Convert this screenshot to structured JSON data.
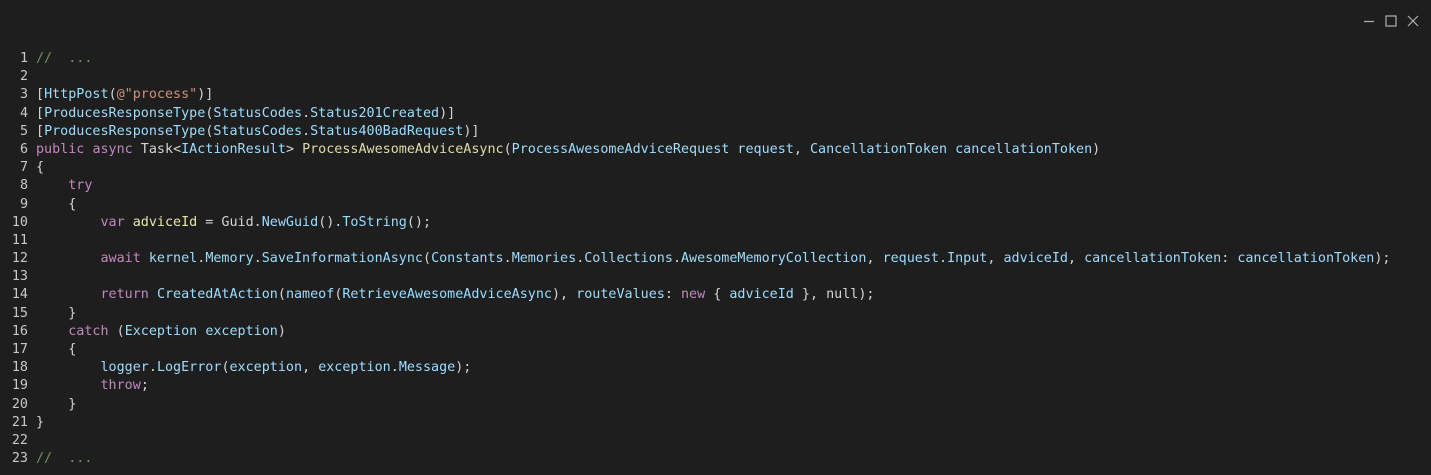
{
  "window": {
    "controls": {
      "minimize": "minimize-icon",
      "maximize": "maximize-icon",
      "close": "close-icon"
    }
  },
  "colors": {
    "background": "#1e1e1e",
    "comment": "#6a9955",
    "keyword": "#c586c0",
    "identifier": "#9cdcfe",
    "function": "#dcdcaa",
    "string": "#ce9178",
    "plain": "#d4d4d4"
  },
  "code": {
    "lines": [
      {
        "n": "1",
        "tokens": [
          {
            "c": "t-comment",
            "t": "//  ..."
          }
        ]
      },
      {
        "n": "2",
        "tokens": []
      },
      {
        "n": "3",
        "tokens": [
          {
            "c": "t-plain",
            "t": "["
          },
          {
            "c": "t-type",
            "t": "HttpPost"
          },
          {
            "c": "t-plain",
            "t": "("
          },
          {
            "c": "t-string",
            "t": "@\"process\""
          },
          {
            "c": "t-plain",
            "t": ")]"
          }
        ]
      },
      {
        "n": "4",
        "tokens": [
          {
            "c": "t-plain",
            "t": "["
          },
          {
            "c": "t-type",
            "t": "ProducesResponseType"
          },
          {
            "c": "t-plain",
            "t": "("
          },
          {
            "c": "t-type",
            "t": "StatusCodes"
          },
          {
            "c": "t-plain",
            "t": "."
          },
          {
            "c": "t-type",
            "t": "Status201Created"
          },
          {
            "c": "t-plain",
            "t": ")]"
          }
        ]
      },
      {
        "n": "5",
        "tokens": [
          {
            "c": "t-plain",
            "t": "["
          },
          {
            "c": "t-type",
            "t": "ProducesResponseType"
          },
          {
            "c": "t-plain",
            "t": "("
          },
          {
            "c": "t-type",
            "t": "StatusCodes"
          },
          {
            "c": "t-plain",
            "t": "."
          },
          {
            "c": "t-type",
            "t": "Status400BadRequest"
          },
          {
            "c": "t-plain",
            "t": ")]"
          }
        ]
      },
      {
        "n": "6",
        "tokens": [
          {
            "c": "t-keyword",
            "t": "public"
          },
          {
            "c": "t-plain",
            "t": " "
          },
          {
            "c": "t-keyword",
            "t": "async"
          },
          {
            "c": "t-plain",
            "t": " Task<"
          },
          {
            "c": "t-type",
            "t": "IActionResult"
          },
          {
            "c": "t-plain",
            "t": "> "
          },
          {
            "c": "t-func",
            "t": "ProcessAwesomeAdviceAsync"
          },
          {
            "c": "t-plain",
            "t": "("
          },
          {
            "c": "t-type",
            "t": "ProcessAwesomeAdviceRequest"
          },
          {
            "c": "t-plain",
            "t": " "
          },
          {
            "c": "t-var",
            "t": "request"
          },
          {
            "c": "t-plain",
            "t": ", "
          },
          {
            "c": "t-type",
            "t": "CancellationToken"
          },
          {
            "c": "t-plain",
            "t": " "
          },
          {
            "c": "t-var",
            "t": "cancellationToken"
          },
          {
            "c": "t-plain",
            "t": ")"
          }
        ]
      },
      {
        "n": "7",
        "tokens": [
          {
            "c": "t-plain",
            "t": "{"
          }
        ]
      },
      {
        "n": "8",
        "tokens": [
          {
            "c": "t-plain",
            "t": "    "
          },
          {
            "c": "t-keyword",
            "t": "try"
          }
        ]
      },
      {
        "n": "9",
        "tokens": [
          {
            "c": "t-plain",
            "t": "    {"
          }
        ]
      },
      {
        "n": "10",
        "tokens": [
          {
            "c": "t-plain",
            "t": "        "
          },
          {
            "c": "t-keyword",
            "t": "var"
          },
          {
            "c": "t-plain",
            "t": " "
          },
          {
            "c": "t-light",
            "t": "adviceId"
          },
          {
            "c": "t-plain",
            "t": " = Guid."
          },
          {
            "c": "t-type",
            "t": "NewGuid"
          },
          {
            "c": "t-plain",
            "t": "()."
          },
          {
            "c": "t-type",
            "t": "ToString"
          },
          {
            "c": "t-plain",
            "t": "();"
          }
        ]
      },
      {
        "n": "11",
        "tokens": []
      },
      {
        "n": "12",
        "tokens": [
          {
            "c": "t-plain",
            "t": "        "
          },
          {
            "c": "t-keyword",
            "t": "await"
          },
          {
            "c": "t-plain",
            "t": " "
          },
          {
            "c": "t-var",
            "t": "kernel"
          },
          {
            "c": "t-plain",
            "t": "."
          },
          {
            "c": "t-type",
            "t": "Memory"
          },
          {
            "c": "t-plain",
            "t": "."
          },
          {
            "c": "t-type",
            "t": "SaveInformationAsync"
          },
          {
            "c": "t-plain",
            "t": "("
          },
          {
            "c": "t-type",
            "t": "Constants"
          },
          {
            "c": "t-plain",
            "t": "."
          },
          {
            "c": "t-type",
            "t": "Memories"
          },
          {
            "c": "t-plain",
            "t": "."
          },
          {
            "c": "t-type",
            "t": "Collections"
          },
          {
            "c": "t-plain",
            "t": "."
          },
          {
            "c": "t-type",
            "t": "AwesomeMemoryCollection"
          },
          {
            "c": "t-plain",
            "t": ", "
          },
          {
            "c": "t-var",
            "t": "request"
          },
          {
            "c": "t-plain",
            "t": "."
          },
          {
            "c": "t-type",
            "t": "Input"
          },
          {
            "c": "t-plain",
            "t": ", "
          },
          {
            "c": "t-var",
            "t": "adviceId"
          },
          {
            "c": "t-plain",
            "t": ", "
          },
          {
            "c": "t-var",
            "t": "cancellationToken"
          },
          {
            "c": "t-plain",
            "t": ": "
          },
          {
            "c": "t-var",
            "t": "cancellationToken"
          },
          {
            "c": "t-plain",
            "t": ");"
          }
        ]
      },
      {
        "n": "13",
        "tokens": []
      },
      {
        "n": "14",
        "tokens": [
          {
            "c": "t-plain",
            "t": "        "
          },
          {
            "c": "t-keyword",
            "t": "return"
          },
          {
            "c": "t-plain",
            "t": " "
          },
          {
            "c": "t-type",
            "t": "CreatedAtAction"
          },
          {
            "c": "t-plain",
            "t": "("
          },
          {
            "c": "t-type",
            "t": "nameof"
          },
          {
            "c": "t-plain",
            "t": "("
          },
          {
            "c": "t-type",
            "t": "RetrieveAwesomeAdviceAsync"
          },
          {
            "c": "t-plain",
            "t": "), "
          },
          {
            "c": "t-var",
            "t": "routeValues"
          },
          {
            "c": "t-plain",
            "t": ": "
          },
          {
            "c": "t-keyword",
            "t": "new"
          },
          {
            "c": "t-plain",
            "t": " { "
          },
          {
            "c": "t-var",
            "t": "adviceId"
          },
          {
            "c": "t-plain",
            "t": " }, null);"
          }
        ]
      },
      {
        "n": "15",
        "tokens": [
          {
            "c": "t-plain",
            "t": "    }"
          }
        ]
      },
      {
        "n": "16",
        "tokens": [
          {
            "c": "t-plain",
            "t": "    "
          },
          {
            "c": "t-keyword",
            "t": "catch"
          },
          {
            "c": "t-plain",
            "t": " ("
          },
          {
            "c": "t-type",
            "t": "Exception"
          },
          {
            "c": "t-plain",
            "t": " "
          },
          {
            "c": "t-var",
            "t": "exception"
          },
          {
            "c": "t-plain",
            "t": ")"
          }
        ]
      },
      {
        "n": "17",
        "tokens": [
          {
            "c": "t-plain",
            "t": "    {"
          }
        ]
      },
      {
        "n": "18",
        "tokens": [
          {
            "c": "t-plain",
            "t": "        "
          },
          {
            "c": "t-var",
            "t": "logger"
          },
          {
            "c": "t-plain",
            "t": "."
          },
          {
            "c": "t-type",
            "t": "LogError"
          },
          {
            "c": "t-plain",
            "t": "("
          },
          {
            "c": "t-var",
            "t": "exception"
          },
          {
            "c": "t-plain",
            "t": ", "
          },
          {
            "c": "t-var",
            "t": "exception"
          },
          {
            "c": "t-plain",
            "t": "."
          },
          {
            "c": "t-type",
            "t": "Message"
          },
          {
            "c": "t-plain",
            "t": ");"
          }
        ]
      },
      {
        "n": "19",
        "tokens": [
          {
            "c": "t-plain",
            "t": "        "
          },
          {
            "c": "t-keyword",
            "t": "throw"
          },
          {
            "c": "t-plain",
            "t": ";"
          }
        ]
      },
      {
        "n": "20",
        "tokens": [
          {
            "c": "t-plain",
            "t": "    }"
          }
        ]
      },
      {
        "n": "21",
        "tokens": [
          {
            "c": "t-plain",
            "t": "}"
          }
        ]
      },
      {
        "n": "22",
        "tokens": []
      },
      {
        "n": "23",
        "tokens": [
          {
            "c": "t-comment",
            "t": "//  ..."
          }
        ]
      }
    ]
  }
}
